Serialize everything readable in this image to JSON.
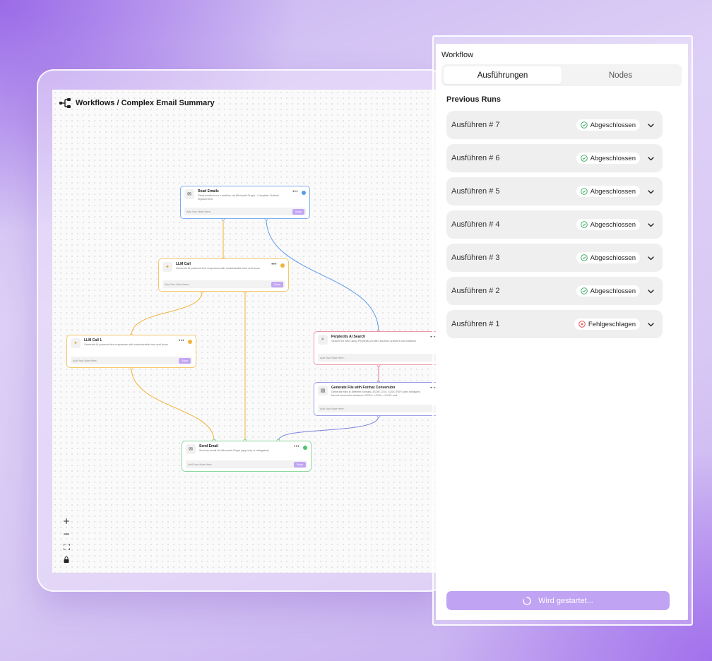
{
  "canvas": {
    "breadcrumb": "Workflows / Complex Email Summary",
    "nodes": {
      "read_emails": {
        "title": "Read Emails",
        "description": "Read emails from a mailbox via Microsoft Graph - Complete Outlook replacement",
        "note_placeholder": "Add Your Note Here..",
        "save_label": "Save",
        "color": "#5b9be8"
      },
      "llm_call": {
        "title": "LLM Call",
        "description": "Generate AI-powered text responses with customizable tone and focus",
        "note_placeholder": "Add Your Note Here..",
        "save_label": "Save",
        "color": "#f2b23a"
      },
      "llm_call_1": {
        "title": "LLM Call 1",
        "description": "Generate AI-powered text responses with customizable tone and focus",
        "note_placeholder": "Add Your Note Here..",
        "save_label": "Save",
        "color": "#f2b23a"
      },
      "perplexity": {
        "title": "Perplexity AI Search",
        "description": "Search the web using Perplexity AI with real-time answers and citations",
        "note_placeholder": "Add Your Note Here..",
        "save_label": "Sa",
        "color": "#e8748a"
      },
      "generate_file": {
        "title": "Generate File with Format Conversion",
        "description": "Generate files in different formats (JSON, CSV, XLSX, PDF) with intelligent format conversion between JSON<->CSV<->XLSX and...",
        "note_placeholder": "Add Your Note Here..",
        "save_label": "Sa",
        "color": "#7b83dd"
      },
      "send_email": {
        "title": "Send Email",
        "description": "Send an email via Microsoft Graph (app-only or delegated)",
        "note_placeholder": "Add Your Note Here..",
        "save_label": "Save",
        "color": "#4cc46a"
      }
    },
    "zoom_controls": {
      "zoom_in": "+",
      "zoom_out": "−",
      "fit": "⛶",
      "lock": "🔒"
    }
  },
  "panel": {
    "title": "Workflow",
    "tabs": [
      {
        "label": "Ausführungen",
        "active": true
      },
      {
        "label": "Nodes",
        "active": false
      }
    ],
    "section_title": "Previous Runs",
    "runs": [
      {
        "label": "Ausführen # 7",
        "status": "Abgeschlossen",
        "state": "success"
      },
      {
        "label": "Ausführen # 6",
        "status": "Abgeschlossen",
        "state": "success"
      },
      {
        "label": "Ausführen # 5",
        "status": "Abgeschlossen",
        "state": "success"
      },
      {
        "label": "Ausführen # 4",
        "status": "Abgeschlossen",
        "state": "success"
      },
      {
        "label": "Ausführen # 3",
        "status": "Abgeschlossen",
        "state": "success"
      },
      {
        "label": "Ausführen # 2",
        "status": "Abgeschlossen",
        "state": "success"
      },
      {
        "label": "Ausführen # 1",
        "status": "Fehlgeschlagen",
        "state": "failed"
      }
    ],
    "start_button_label": "Wird gestartet...",
    "colors": {
      "accent": "#c0a3f3",
      "success": "#2fa35a",
      "failed": "#e0474c"
    }
  }
}
